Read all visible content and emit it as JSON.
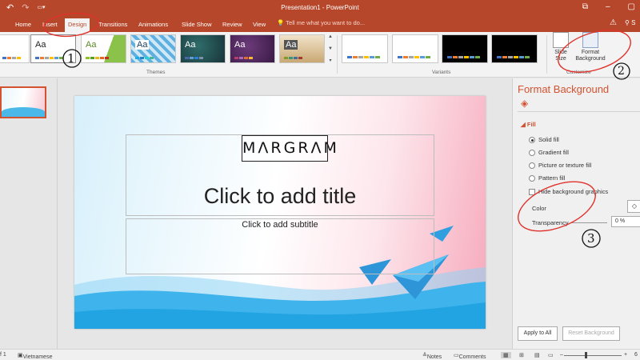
{
  "window": {
    "title": "Presentation1 - PowerPoint",
    "qat_icons": [
      "undo-icon",
      "redo-icon",
      "customize-qat-icon"
    ],
    "controls": [
      "restore-icon",
      "minimize-icon",
      "maximize-icon"
    ]
  },
  "tabs": [
    {
      "label": "Home",
      "active": false
    },
    {
      "label": "Insert",
      "active": false
    },
    {
      "label": "Design",
      "active": true
    },
    {
      "label": "Transitions",
      "active": false
    },
    {
      "label": "Animations",
      "active": false
    },
    {
      "label": "Slide Show",
      "active": false
    },
    {
      "label": "Review",
      "active": false
    },
    {
      "label": "View",
      "active": false
    }
  ],
  "tell_me": "Tell me what you want to do...",
  "user_initial": "S",
  "ribbon": {
    "themes_label": "Themes",
    "variants_label": "Variants",
    "customize_label": "Customize",
    "theme_aa": "Aa",
    "slide_size_label": "Slide Size",
    "format_background_label": "Format Background"
  },
  "slide": {
    "logo_text": "MΛRGRΛM",
    "title_placeholder": "Click to add title",
    "subtitle_placeholder": "Click to add subtitle"
  },
  "pane": {
    "title": "Format Background",
    "fill_header": "Fill",
    "options": [
      {
        "label": "Solid fill",
        "selected": true
      },
      {
        "label": "Gradient fill",
        "selected": false
      },
      {
        "label": "Picture or texture fill",
        "selected": false
      },
      {
        "label": "Pattern fill",
        "selected": false
      }
    ],
    "hide_graphics_label": "Hide background graphics",
    "color_label": "Color",
    "transparency_label": "Transparency",
    "transparency_value": "0 %",
    "apply_all_label": "Apply to All",
    "reset_label": "Reset Background"
  },
  "annotations": [
    "1",
    "2",
    "3"
  ],
  "status": {
    "slide_count": "f 1",
    "language": "Vietnamese",
    "notes_label": "Notes",
    "comments_label": "Comments",
    "zoom_value": "6"
  },
  "colors": {
    "accent": "#b7472a",
    "pane_accent": "#d35230",
    "annotation": "#e0312b"
  }
}
